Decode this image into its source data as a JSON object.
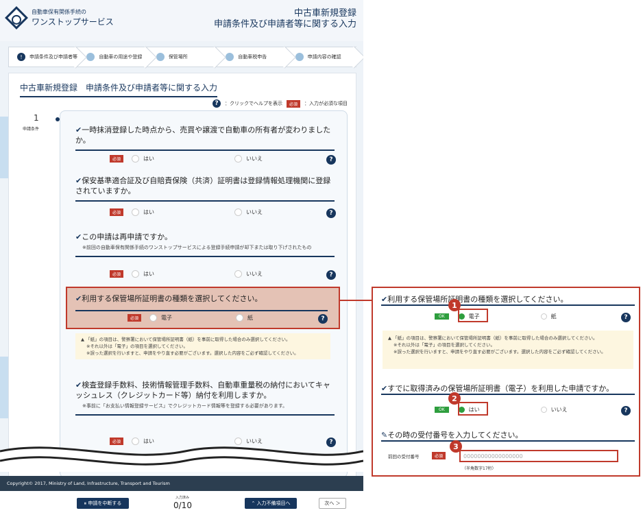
{
  "header": {
    "logo_small": "自動車保有関係手続の",
    "logo_big": "ワンストップサービス",
    "title_line1": "中古車新規登録",
    "title_line2": "申請条件及び申請者等に関する入力"
  },
  "steps": [
    {
      "icon": "!",
      "label": "申請条件及び申請者等"
    },
    {
      "icon": "〇",
      "label": "自動車の用途や登録"
    },
    {
      "icon": "〇",
      "label": "保管場所"
    },
    {
      "icon": "〇",
      "label": "自動車税申告"
    },
    {
      "icon": "〇",
      "label": "申請内容の確認"
    }
  ],
  "panel": {
    "title": "中古車新規登録　申請条件及び申請者等に関する入力",
    "legend_help": "：クリックでヘルプを表示",
    "legend_required": "：入力が必須な項目",
    "required_tag": "必須",
    "section_number": "1",
    "section_label": "申請条件"
  },
  "questions": [
    {
      "text": "一時抹消登録した時点から、売買や譲渡で自動車の所有者が変わりましたか。",
      "yes": "はい",
      "no": "いいえ"
    },
    {
      "text": "保安基準適合証及び自賠責保険（共済）証明書は登録情報処理機関に登録されていますか。",
      "yes": "はい",
      "no": "いいえ"
    },
    {
      "text": "この申請は再申請ですか。",
      "note": "※前回の自動車保有関係手続のワンストップサービスによる登録手続申請が却下または取り下げされたもの",
      "yes": "はい",
      "no": "いいえ"
    },
    {
      "text": "利用する保管場所証明書の種類を選択してください。",
      "yes": "電子",
      "no": "紙"
    },
    {
      "text": "検査登録手数料、技術情報管理手数料、自動車重量税の納付においてキャッシュレス（クレジットカード等）納付を利用しますか。",
      "note": "※事前に「お支払い情報登録サービス」でクレジットカード情報等を登録する必要があります。",
      "yes": "はい",
      "no": "いいえ"
    }
  ],
  "warning": {
    "line1": "「紙」の項目は、警察署において保管場所証明書（紙）を事前に取得した場合のみ選択してください。",
    "line2": "※それ以外は「電子」の項目を選択してください。",
    "line3": "※誤った選択を行いますと、申請をやり直す必要がございます。選択した内容をご必ず確認してください。"
  },
  "footer": {
    "copyright": "Copyright© 2017, Ministry of Land, Infrastructure, Transport and Tourism",
    "stop_button": "申請を中断する",
    "counter_label": "入力済み",
    "counter": "0/10",
    "required_nav_button": "入力不備項目へ",
    "next_button": "次へ ＞"
  },
  "zoom": {
    "q1": "利用する保管場所証明書の種類を選択してください。",
    "q1_selected": "電子",
    "q1_other": "紙",
    "ok_tag": "OK",
    "q2": "すでに取得済みの保管場所証明書（電子）を利用した申請ですか。",
    "q2_selected": "はい",
    "q2_other": "いいえ",
    "q3": "その時の受付番号を入力してください。",
    "field_label": "前回の受付番号",
    "field_required": "必須",
    "field_placeholder": "00000000000000000",
    "field_hint": "（半角数字17桁）",
    "badge1": "1",
    "badge2": "2",
    "badge3": "3"
  },
  "colors": {
    "navy": "#17365d",
    "required_red": "#c0392b",
    "ok_green": "#2e9e3e",
    "highlight_bg": "#e4c2b5",
    "warning_bg": "#fdf6e0"
  }
}
